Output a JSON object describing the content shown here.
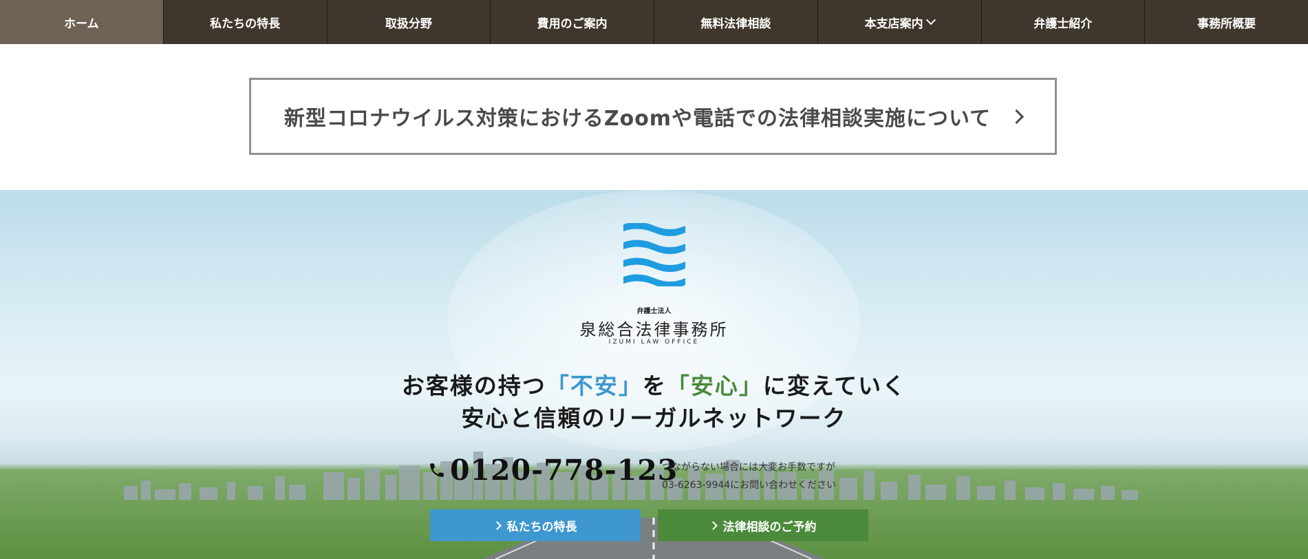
{
  "nav": {
    "items": [
      {
        "label": "ホーム"
      },
      {
        "label": "私たちの特長"
      },
      {
        "label": "取扱分野"
      },
      {
        "label": "費用のご案内"
      },
      {
        "label": "無料法律相談"
      },
      {
        "label": "本支店案内"
      },
      {
        "label": "弁護士紹介"
      },
      {
        "label": "事務所概要"
      }
    ]
  },
  "notice": {
    "text": "新型コロナウイルス対策におけるZoomや電話での法律相談実施について"
  },
  "hero": {
    "firm_sub": "弁護士法人",
    "firm_name": "泉総合法律事務所",
    "firm_en": "IZUMI LAW OFFICE",
    "tagline1_a": "お客様の持つ",
    "tagline1_b": "「不安」",
    "tagline1_c": "を",
    "tagline1_d": "「安心」",
    "tagline1_e": "に変えていく",
    "tagline2": "安心と信頼のリーガルネットワーク",
    "phone": "0120-778-123",
    "alt_line1": "つながらない場合には大変お手数ですが",
    "alt_line2": "03-6263-9944にお問い合わせください",
    "btn_features": "私たちの特長",
    "btn_reserve": "法律相談のご予約"
  },
  "colors": {
    "nav_bg": "#3f372d",
    "accent_blue": "#3e97cf",
    "accent_green": "#4b8a3b",
    "logo_blue": "#1f9de0"
  }
}
